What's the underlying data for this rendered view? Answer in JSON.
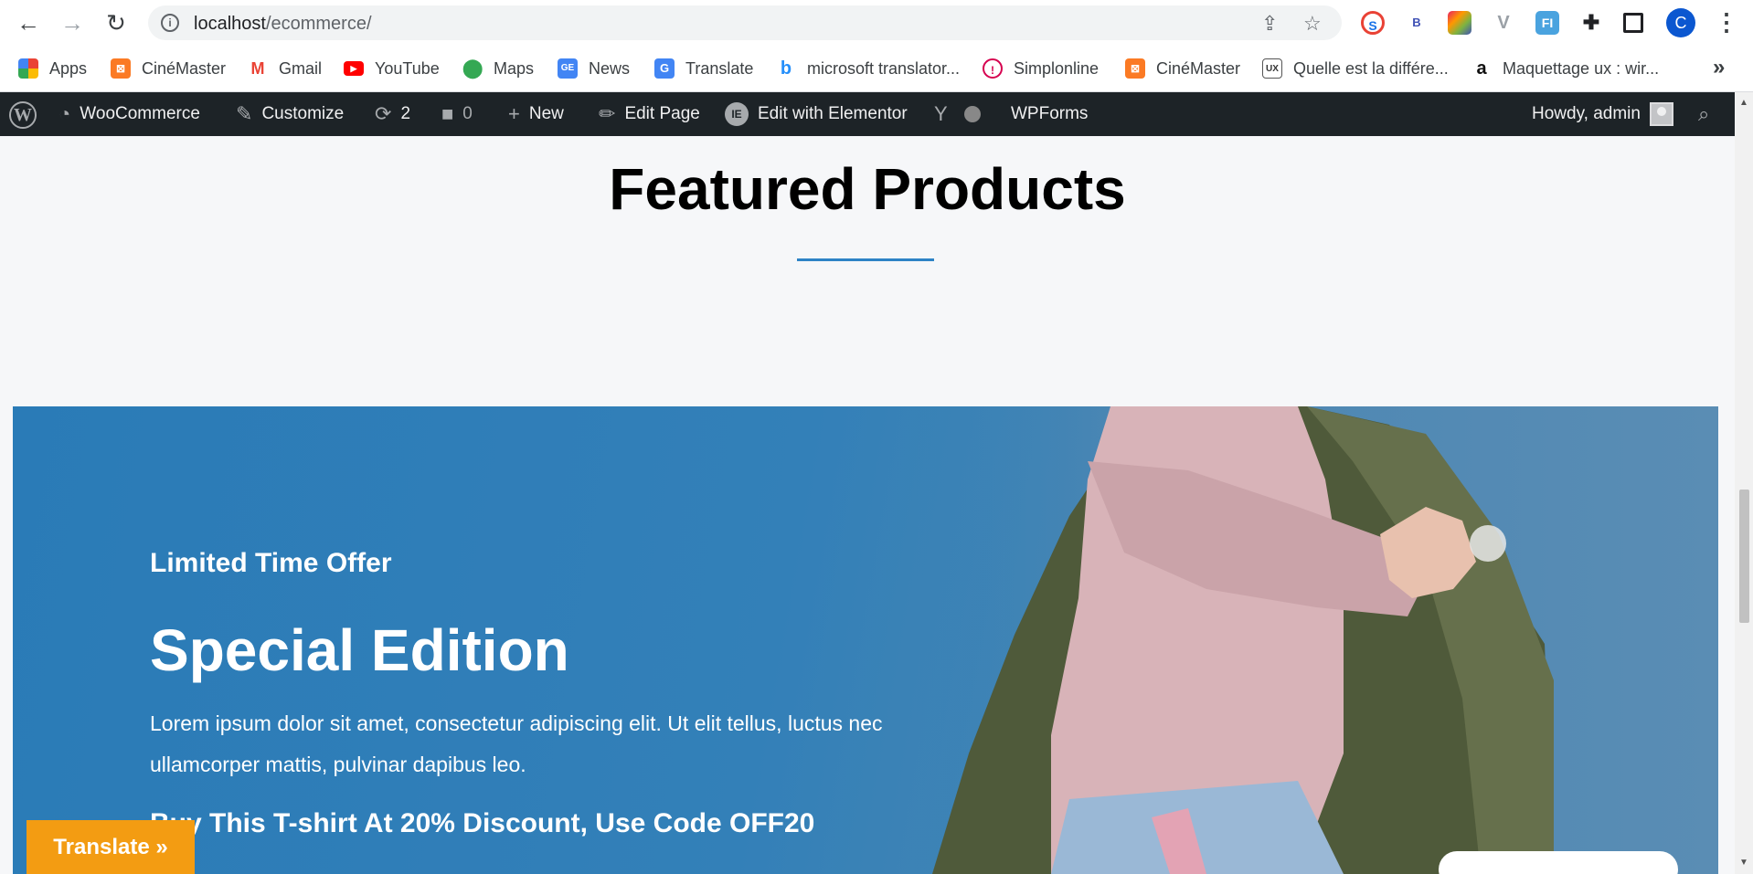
{
  "browser": {
    "url_host": "localhost",
    "url_path": "/ecommerce/",
    "profile_initial": "C",
    "extensions": [
      {
        "name": "translator-ext-icon",
        "label": "",
        "color": "#e94235"
      },
      {
        "name": "b-ext-icon",
        "label": "B",
        "color": "#ffffff"
      },
      {
        "name": "colorful-ext-icon",
        "label": "",
        "color": "#7cb342"
      },
      {
        "name": "v-ext-icon",
        "label": "V",
        "color": "#9aa0a6"
      },
      {
        "name": "fi-ext-icon",
        "label": "FI",
        "color": "#4aa3df"
      }
    ]
  },
  "bookmarks": [
    {
      "label": "Apps",
      "icon": "apps-grid-icon",
      "color": "#ea4335"
    },
    {
      "label": "CinéMaster",
      "icon": "xampp-icon",
      "color": "#fb7a24"
    },
    {
      "label": "Gmail",
      "icon": "gmail-icon",
      "color": "#ea4335"
    },
    {
      "label": "YouTube",
      "icon": "youtube-icon",
      "color": "#ff0000"
    },
    {
      "label": "Maps",
      "icon": "maps-pin-icon",
      "color": "#34a853"
    },
    {
      "label": "News",
      "icon": "google-news-icon",
      "color": "#4285f4"
    },
    {
      "label": "Translate",
      "icon": "google-translate-icon",
      "color": "#4285f4"
    },
    {
      "label": "microsoft translator...",
      "icon": "bing-icon",
      "color": "#258ffa"
    },
    {
      "label": "Simplonline",
      "icon": "simplonline-icon",
      "color": "#d6004f"
    },
    {
      "label": "CinéMaster",
      "icon": "xampp-icon",
      "color": "#fb7a24"
    },
    {
      "label": "Quelle est la différe...",
      "icon": "blog-ux-icon",
      "color": "#555555"
    },
    {
      "label": "Maquettage ux : wir...",
      "icon": "amazon-icon",
      "color": "#111111"
    }
  ],
  "adminbar": {
    "woocommerce": "WooCommerce",
    "customize": "Customize",
    "updates_count": "2",
    "comments_count": "0",
    "new": "New",
    "edit_page": "Edit Page",
    "elementor": "Edit with Elementor",
    "wpforms": "WPForms",
    "howdy": "Howdy, admin"
  },
  "section": {
    "title": "Featured Products",
    "accent_color": "#2d83c6"
  },
  "hero": {
    "kicker": "Limited Time Offer",
    "headline": "Special Edition",
    "body": "Lorem ipsum dolor sit amet, consectetur adipiscing elit. Ut elit tellus, luctus nec ullamcorper mattis, pulvinar dapibus leo.",
    "promo": "Buy This T-shirt At 20% Discount, Use Code OFF20",
    "background_color": "#2f7db8"
  },
  "translate_widget": {
    "label": "Translate »",
    "color": "#f39c12"
  }
}
